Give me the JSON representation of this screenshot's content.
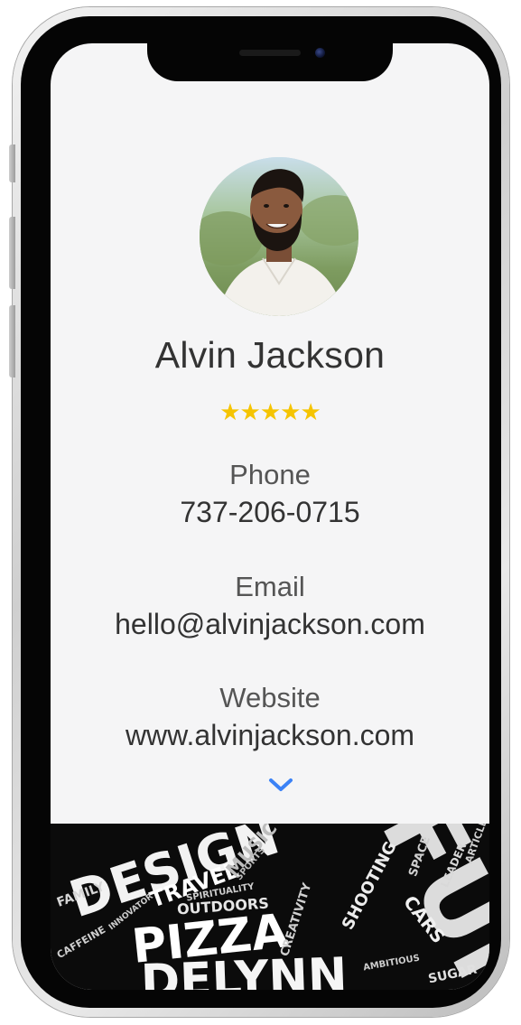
{
  "profile": {
    "name": "Alvin Jackson",
    "rating": 5,
    "stars_text": "★★★★★"
  },
  "contact": {
    "phone_label": "Phone",
    "phone_value": "737-206-0715",
    "email_label": "Email",
    "email_value": "hello@alvinjackson.com",
    "website_label": "Website",
    "website_value": "www.alvinjackson.com"
  },
  "icons": {
    "scroll": "chevron-down-icon"
  },
  "colors": {
    "star": "#f5c400",
    "chevron": "#3b82f6",
    "text": "#333333",
    "background": "#f5f5f6"
  },
  "banner_words": [
    "DESIGN",
    "FUN",
    "PIZZA",
    "TRAVEL",
    "OUTDOORS",
    "MUSIC",
    "SPORTS",
    "FAMILY",
    "CREATIVITY",
    "SHOOTING",
    "SPIRITUALITY",
    "CARS",
    "SPACE",
    "LEADER",
    "INNOVATOR",
    "CAFFEINE",
    "SUGAR",
    "AMBITIOUS",
    "DELYNN",
    "ARTICLE"
  ]
}
